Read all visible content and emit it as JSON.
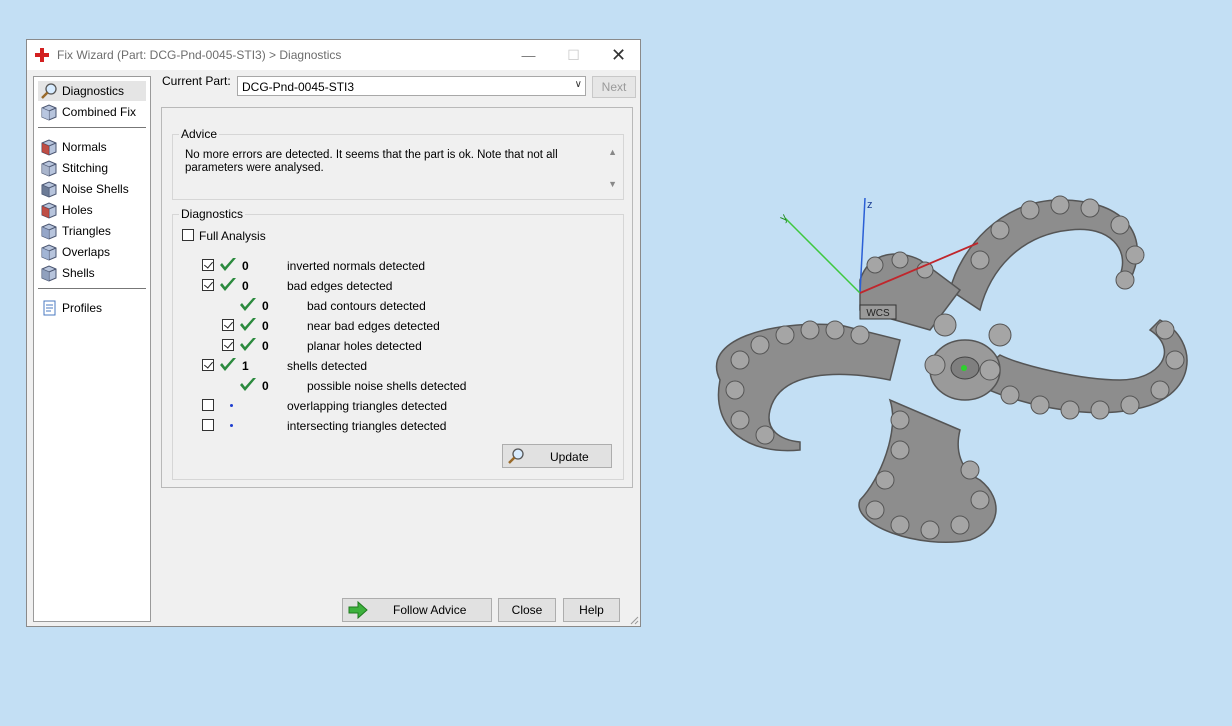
{
  "window": {
    "title": "Fix Wizard (Part: DCG-Pnd-0045-STI3) > Diagnostics",
    "minimize_symbol": "—",
    "maximize_symbol": "☐",
    "close_symbol": "✕"
  },
  "sidebar": {
    "groups": [
      [
        {
          "label": "Diagnostics",
          "icon": "magnifier-icon",
          "selected": true
        },
        {
          "label": "Combined Fix",
          "icon": "combined-fix-icon"
        }
      ],
      [
        {
          "label": "Normals",
          "icon": "normals-icon"
        },
        {
          "label": "Stitching",
          "icon": "stitching-icon"
        },
        {
          "label": "Noise Shells",
          "icon": "noise-shells-icon"
        },
        {
          "label": "Holes",
          "icon": "holes-icon"
        },
        {
          "label": "Triangles",
          "icon": "triangles-icon"
        },
        {
          "label": "Overlaps",
          "icon": "overlaps-icon"
        },
        {
          "label": "Shells",
          "icon": "shells-icon"
        }
      ],
      [
        {
          "label": "Profiles",
          "icon": "profiles-icon"
        }
      ]
    ]
  },
  "current_part": {
    "label": "Current Part:",
    "value": "DCG-Pnd-0045-STI3",
    "next_label": "Next"
  },
  "advice": {
    "title": "Advice",
    "text": "No more errors are detected. It seems that the part is ok. Note that not all parameters were analysed."
  },
  "diagnostics": {
    "title": "Diagnostics",
    "full_analysis_label": "Full Analysis",
    "full_analysis_checked": false,
    "rows": [
      {
        "checkbox": true,
        "checked": true,
        "status": "ok",
        "count": "0",
        "label": "inverted normals detected",
        "indent": 0
      },
      {
        "checkbox": true,
        "checked": true,
        "status": "ok",
        "count": "0",
        "label": "bad edges detected",
        "indent": 0
      },
      {
        "checkbox": false,
        "checked": false,
        "status": "ok",
        "count": "0",
        "label": "bad contours detected",
        "indent": 1
      },
      {
        "checkbox": true,
        "checked": true,
        "status": "ok",
        "count": "0",
        "label": "near bad edges detected",
        "indent": 1
      },
      {
        "checkbox": true,
        "checked": true,
        "status": "ok",
        "count": "0",
        "label": "planar holes detected",
        "indent": 1
      },
      {
        "checkbox": true,
        "checked": true,
        "status": "ok",
        "count": "1",
        "label": "shells detected",
        "indent": 0
      },
      {
        "checkbox": false,
        "checked": false,
        "status": "ok",
        "count": "0",
        "label": "possible noise shells detected",
        "indent": 1
      },
      {
        "checkbox": true,
        "checked": false,
        "status": "pending",
        "count": "",
        "label": "overlapping triangles detected",
        "indent": 0
      },
      {
        "checkbox": true,
        "checked": false,
        "status": "pending",
        "count": "",
        "label": "intersecting triangles detected",
        "indent": 0
      }
    ],
    "update_label": "Update"
  },
  "footer": {
    "follow_advice_label": "Follow Advice",
    "close_label": "Close",
    "help_label": "Help"
  },
  "viewport": {
    "axis_z": "z",
    "axis_y": "y",
    "wcs_label": "WCS",
    "colors": {
      "background": "#c3dff4",
      "model": "#8d8d8d",
      "axis_x": "#c0262c",
      "axis_y": "#3ec83e",
      "axis_z": "#2a5fd6"
    }
  },
  "colors": {
    "ok_tick": "#2b8a3e",
    "pending_dot": "#1f3fd0"
  }
}
